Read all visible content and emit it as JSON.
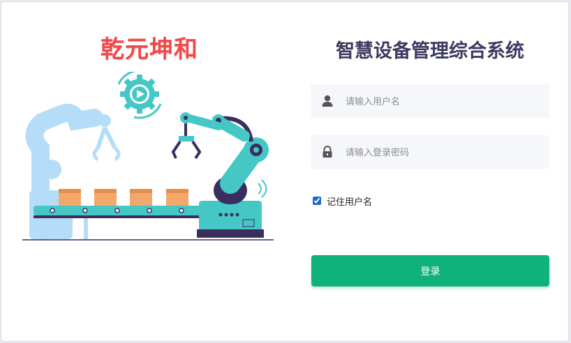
{
  "brand": {
    "name": "乾元坤和"
  },
  "system_title": "智慧设备管理综合系统",
  "login_form": {
    "username_placeholder": "请输入用户名",
    "password_placeholder": "请输入登录密码",
    "remember_label": "记住用户名",
    "remember_checked": true,
    "submit_label": "登录"
  },
  "icons": {
    "username": "user-icon",
    "password": "lock-icon",
    "illustration": "factory-robot-arms-illustration"
  },
  "colors": {
    "brand": "#f0484b",
    "title": "#3c3a5e",
    "button": "#0eb27a",
    "field_bg": "#f5f7fb",
    "teal": "#45c7c5",
    "light_blue": "#b6ddf7",
    "navy": "#3a2e5e",
    "box": "#f2a86b"
  }
}
